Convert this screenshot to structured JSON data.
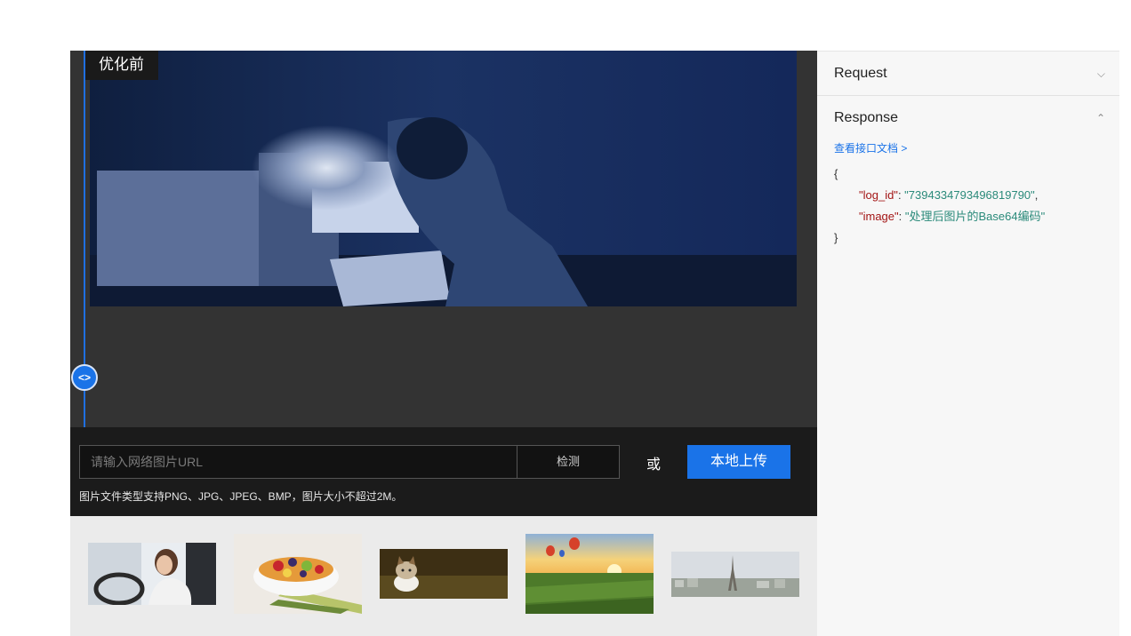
{
  "demo": {
    "before_label": "优化前",
    "divider_handle_label": "<>",
    "url_input": {
      "placeholder": "请输入网络图片URL",
      "value": ""
    },
    "detect_button": "检测",
    "or_text": "或",
    "upload_button": "本地上传",
    "hint": "图片文件类型支持PNG、JPG、JPEG、BMP，图片大小不超过2M。",
    "samples": [
      "driver-woman",
      "fruit-bowl",
      "kitten",
      "hot-air-balloons",
      "eiffel-tower"
    ]
  },
  "side": {
    "request_title": "Request",
    "response_title": "Response",
    "doc_link": "查看接口文档 >",
    "response": {
      "open_brace": "{",
      "close_brace": "}",
      "log_id_key": "\"log_id\"",
      "log_id_value": "\"7394334793496819790\"",
      "image_key": "\"image\"",
      "image_value": "\"处理后图片的Base64编码\"",
      "colon": ": ",
      "comma": ","
    }
  },
  "colors": {
    "accent": "#1a73e8",
    "stage_bg": "#333333",
    "controls_bg": "#1b1b1b",
    "json_key": "#a31515",
    "json_value": "#2a8a7a"
  }
}
